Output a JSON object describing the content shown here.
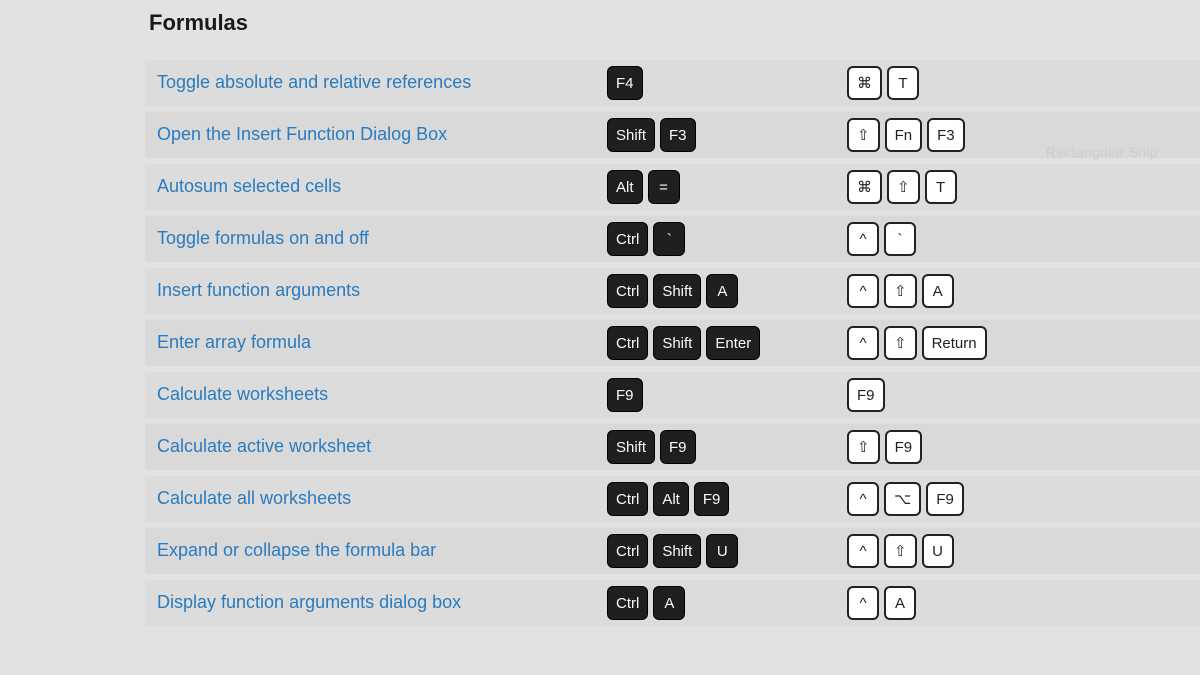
{
  "title": "Formulas",
  "watermark": "Rectangular Snip",
  "keyicons": {
    "cmd": "⌘",
    "shift": "⇧",
    "ctrl": "^",
    "opt": "⌥"
  },
  "rows": [
    {
      "desc": "Toggle absolute and relative references",
      "win": [
        "F4"
      ],
      "mac": [
        "cmd",
        {
          "t": "T"
        }
      ]
    },
    {
      "desc": "Open the Insert Function Dialog Box",
      "win": [
        "Shift",
        "F3"
      ],
      "mac": [
        "shift",
        {
          "t": "Fn"
        },
        {
          "t": "F3"
        }
      ]
    },
    {
      "desc": "Autosum selected cells",
      "win": [
        "Alt",
        "="
      ],
      "mac": [
        "cmd",
        "shift",
        {
          "t": "T"
        }
      ]
    },
    {
      "desc": "Toggle formulas on and off",
      "win": [
        "Ctrl",
        "`"
      ],
      "mac": [
        "ctrl",
        {
          "t": "`"
        }
      ]
    },
    {
      "desc": "Insert function arguments",
      "win": [
        "Ctrl",
        "Shift",
        "A"
      ],
      "mac": [
        "ctrl",
        "shift",
        {
          "t": "A"
        }
      ]
    },
    {
      "desc": "Enter array formula",
      "win": [
        "Ctrl",
        "Shift",
        "Enter"
      ],
      "mac": [
        "ctrl",
        "shift",
        {
          "t": "Return"
        }
      ]
    },
    {
      "desc": "Calculate worksheets",
      "win": [
        "F9"
      ],
      "mac": [
        {
          "t": "F9"
        }
      ]
    },
    {
      "desc": "Calculate active worksheet",
      "win": [
        "Shift",
        "F9"
      ],
      "mac": [
        "shift",
        {
          "t": "F9"
        }
      ]
    },
    {
      "desc": "Calculate all worksheets",
      "win": [
        "Ctrl",
        "Alt",
        "F9"
      ],
      "mac": [
        "ctrl",
        "opt",
        {
          "t": "F9"
        }
      ]
    },
    {
      "desc": "Expand or collapse the formula bar",
      "win": [
        "Ctrl",
        "Shift",
        "U"
      ],
      "mac": [
        "ctrl",
        "shift",
        {
          "t": "U"
        }
      ]
    },
    {
      "desc": "Display function arguments dialog box",
      "win": [
        "Ctrl",
        "A"
      ],
      "mac": [
        "ctrl",
        {
          "t": "A"
        }
      ]
    }
  ]
}
